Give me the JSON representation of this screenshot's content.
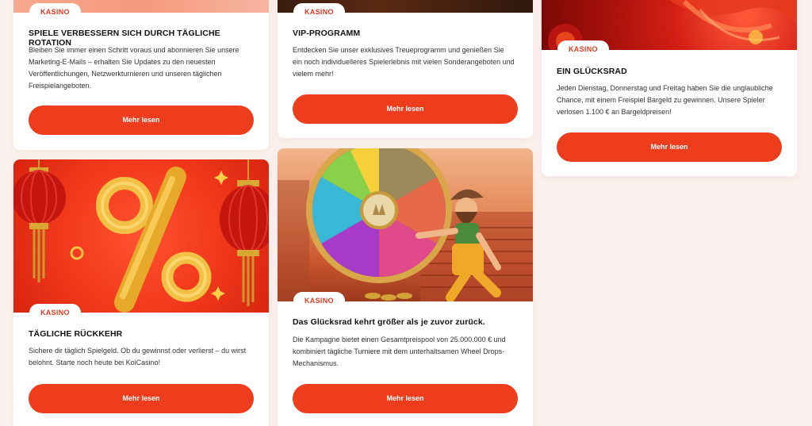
{
  "colors": {
    "page_bg": "#fbf1ee",
    "accent": "#ee3d1c",
    "badge_text": "#e23b22",
    "card_bg": "#ffffff"
  },
  "cards": [
    {
      "badge": "KASINO",
      "title": "SPIELE VERBESSERN SICH DURCH TÄGLICHE ROTATION",
      "text": "Bleiben Sie immer einen Schritt voraus und abonnieren Sie unsere Marketing-E-Mails – erhalten Sie Updates zu den neuesten Veröffentlichungen, Netzwerkturnieren und unseren täglichen Freispielangeboten.",
      "button": "Mehr lesen"
    },
    {
      "badge": "KASINO",
      "title": "VIP-PROGRAMM",
      "text": "Entdecken Sie unser exklusives Treueprogramm und genießen Sie ein noch individuelleres Spielerlebnis mit vielen Sonderangeboten und vielem mehr!",
      "button": "Mehr lesen"
    },
    {
      "badge": "KASINO",
      "title": "EIN GLÜCKSRAD",
      "text": "Jeden Dienstag, Donnerstag und Freitag haben Sie die unglaubliche Chance, mit einem Freispiel Bargeld zu gewinnen. Unsere Spieler verlosen 1.100 € an Bargeldpreisen!",
      "button": "Mehr lesen"
    },
    {
      "badge": "KASINO",
      "title": "TÄGLICHE RÜCKKEHR",
      "text": "Sichere dir täglich Spielgeld. Ob du gewinnst oder verlierst – du wirst belohnt. Starte noch heute bei KoiCasino!",
      "button": "Mehr lesen"
    },
    {
      "badge": "KASINO",
      "title": "Das Glücksrad kehrt größer als je zuvor zurück.",
      "text": "Die Kampagne bietet einen Gesamtpreispool von 25.000.000 € und kombiniert tägliche Turniere mit dem unterhaltsamen Wheel Drops-Mechanismus.",
      "button": "Mehr lesen"
    }
  ]
}
